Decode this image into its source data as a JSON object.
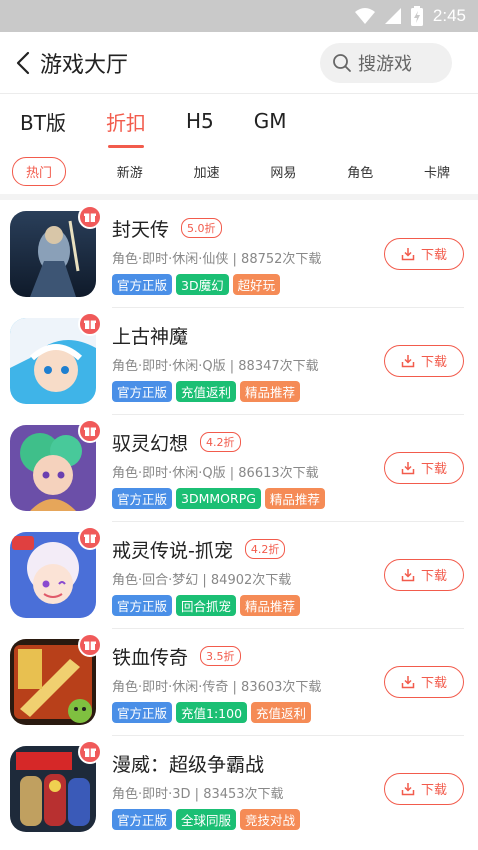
{
  "status_bar": {
    "time": "2:45"
  },
  "header": {
    "title": "游戏大厅",
    "search_placeholder": "搜游戏"
  },
  "tabs": [
    {
      "label": "BT版",
      "active": false
    },
    {
      "label": "折扣",
      "active": true
    },
    {
      "label": "H5",
      "active": false
    },
    {
      "label": "GM",
      "active": false
    }
  ],
  "categories": [
    {
      "label": "热门",
      "active": true
    },
    {
      "label": "新游",
      "active": false
    },
    {
      "label": "加速",
      "active": false
    },
    {
      "label": "网易",
      "active": false
    },
    {
      "label": "角色",
      "active": false
    },
    {
      "label": "卡牌",
      "active": false
    }
  ],
  "colors": {
    "accent": "#f25b4c",
    "tag_blue": "#4a8fe7",
    "tag_green": "#1bbf74",
    "tag_orange": "#f58b56"
  },
  "download_label": "下载",
  "games": [
    {
      "name": "封天传",
      "discount": "5.0折",
      "meta": "角色·即时·休闲·仙侠 | 88752次下载",
      "tags": [
        {
          "text": "官方正版",
          "color": "blue"
        },
        {
          "text": "3D魔幻",
          "color": "green"
        },
        {
          "text": "超好玩",
          "color": "orange"
        }
      ]
    },
    {
      "name": "上古神魔",
      "discount": "",
      "meta": "角色·即时·休闲·Q版 | 88347次下载",
      "tags": [
        {
          "text": "官方正版",
          "color": "blue"
        },
        {
          "text": "充值返利",
          "color": "green"
        },
        {
          "text": "精品推荐",
          "color": "orange"
        }
      ]
    },
    {
      "name": "驭灵幻想",
      "discount": "4.2折",
      "meta": "角色·即时·休闲·Q版 | 86613次下载",
      "tags": [
        {
          "text": "官方正版",
          "color": "blue"
        },
        {
          "text": "3DMMORPG",
          "color": "green"
        },
        {
          "text": "精品推荐",
          "color": "orange"
        }
      ]
    },
    {
      "name": "戒灵传说-抓宠",
      "discount": "4.2折",
      "meta": "角色·回合·梦幻 | 84902次下载",
      "tags": [
        {
          "text": "官方正版",
          "color": "blue"
        },
        {
          "text": "回合抓宠",
          "color": "green"
        },
        {
          "text": "精品推荐",
          "color": "orange"
        }
      ]
    },
    {
      "name": "铁血传奇",
      "discount": "3.5折",
      "meta": "角色·即时·休闲·传奇 | 83603次下载",
      "tags": [
        {
          "text": "官方正版",
          "color": "blue"
        },
        {
          "text": "充值1:100",
          "color": "green"
        },
        {
          "text": "充值返利",
          "color": "orange"
        }
      ]
    },
    {
      "name": "漫威：超级争霸战",
      "discount": "",
      "meta": "角色·即时·3D | 83453次下载",
      "tags": [
        {
          "text": "官方正版",
          "color": "blue"
        },
        {
          "text": "全球同服",
          "color": "green"
        },
        {
          "text": "竞技对战",
          "color": "orange"
        }
      ]
    }
  ]
}
